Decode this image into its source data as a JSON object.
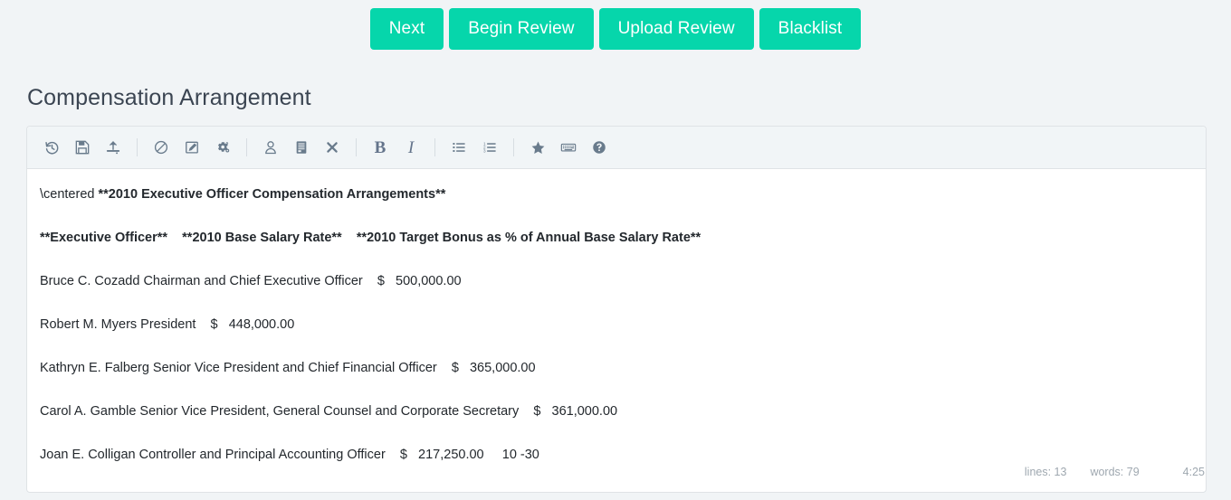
{
  "action_bar": {
    "buttons": [
      {
        "label": "Next",
        "name": "next-button"
      },
      {
        "label": "Begin Review",
        "name": "begin-review-button"
      },
      {
        "label": "Upload Review",
        "name": "upload-review-button"
      },
      {
        "label": "Blacklist",
        "name": "blacklist-button"
      }
    ],
    "accent_color": "#06d6ab",
    "text_color": "#ffffff"
  },
  "page": {
    "title": "Compensation Arrangement",
    "background_color": "#f1f4f6",
    "title_color": "#3b4552"
  },
  "editor": {
    "toolbar": {
      "background_color": "#f1f5f7",
      "icon_color": "#697b8c",
      "groups": [
        [
          {
            "icon": "undo-history-icon"
          },
          {
            "icon": "save-floppy-icon"
          },
          {
            "icon": "upload-icon"
          }
        ],
        [
          {
            "icon": "ban-icon"
          },
          {
            "icon": "edit-pencil-square-icon"
          },
          {
            "icon": "settings-gears-icon"
          }
        ],
        [
          {
            "icon": "user-icon"
          },
          {
            "icon": "document-icon"
          },
          {
            "icon": "remove-x-icon"
          }
        ],
        [
          {
            "icon": "bold-icon",
            "text": "B"
          },
          {
            "icon": "italic-icon",
            "text": "I"
          }
        ],
        [
          {
            "icon": "unordered-list-icon"
          },
          {
            "icon": "ordered-list-icon"
          }
        ],
        [
          {
            "icon": "star-icon"
          },
          {
            "icon": "keyboard-icon"
          },
          {
            "icon": "help-circle-icon"
          }
        ]
      ]
    },
    "content": {
      "lines": [
        [
          {
            "text": "\\centered ",
            "bold": false
          },
          {
            "text": "**2010 Executive Officer Compensation Arrangements**",
            "bold": true
          }
        ],
        [
          {
            "text": "**Executive Officer**    **2010 Base Salary Rate**    **2010 Target Bonus as % of Annual Base Salary Rate**",
            "bold": true
          }
        ],
        [
          {
            "text": "Bruce C. Cozadd Chairman and Chief Executive Officer    $   500,000.00",
            "bold": false
          }
        ],
        [
          {
            "text": "Robert M. Myers President    $   448,000.00",
            "bold": false
          }
        ],
        [
          {
            "text": "Kathryn E. Falberg Senior Vice President and Chief Financial Officer    $   365,000.00",
            "bold": false
          }
        ],
        [
          {
            "text": "Carol A. Gamble Senior Vice President, General Counsel and Corporate Secretary    $   361,000.00",
            "bold": false
          }
        ],
        [
          {
            "text": "Joan E. Colligan Controller and Principal Accounting Officer    $   217,250.00     10 -30",
            "bold": false
          }
        ]
      ]
    }
  },
  "status_bar": {
    "lines_label": "lines: 13",
    "words_label": "words: 79",
    "clock": "4:25"
  }
}
